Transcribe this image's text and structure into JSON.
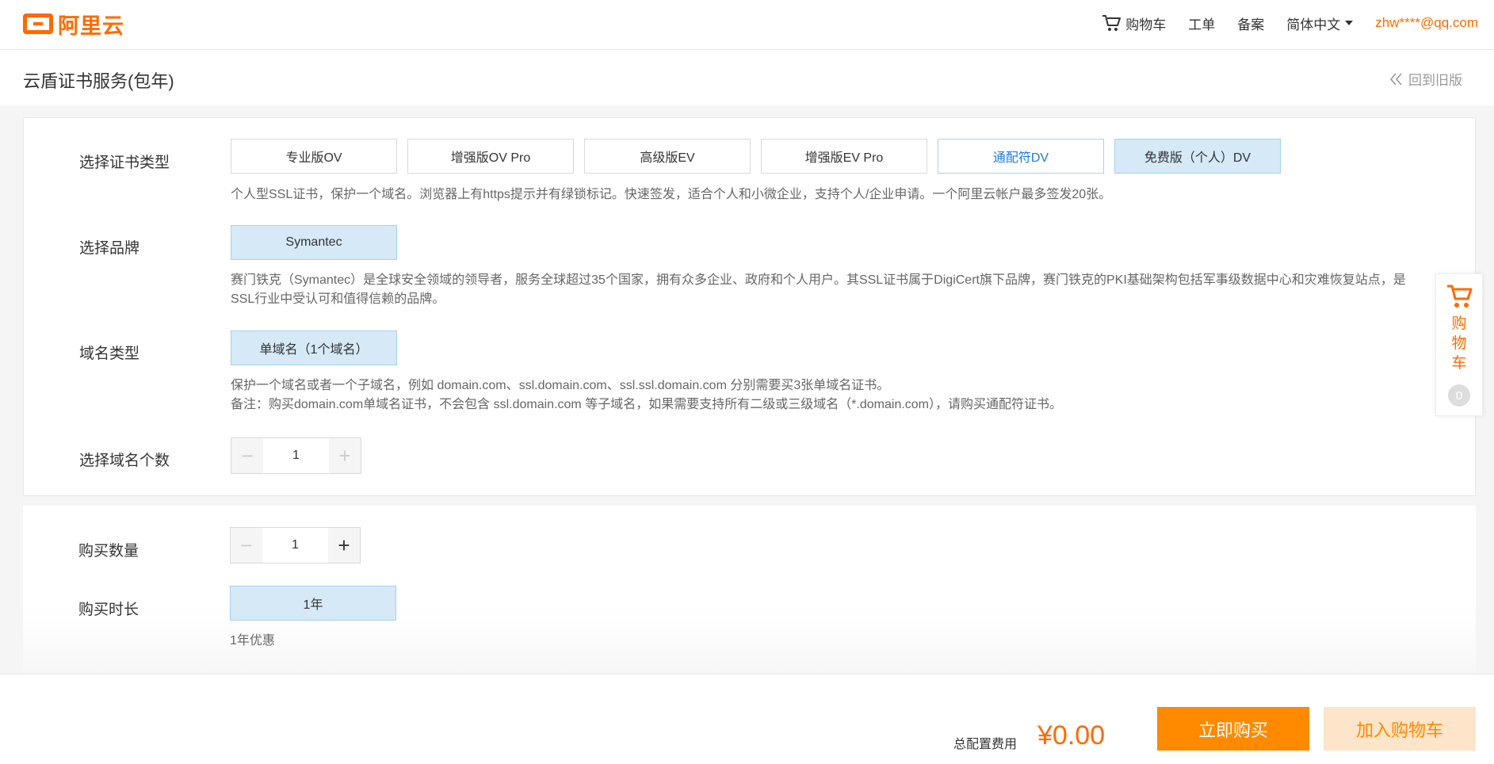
{
  "header": {
    "logo_text": "阿里云",
    "cart_label": "购物车",
    "ticket_label": "工单",
    "filing_label": "备案",
    "language_label": "简体中文",
    "user_label": "zhw****@qq.com"
  },
  "title": {
    "page_title": "云盾证书服务(包年)",
    "back_old_label": "回到旧版"
  },
  "cert_type": {
    "label": "选择证书类型",
    "options": [
      "专业版OV",
      "增强版OV Pro",
      "高级版EV",
      "增强版EV Pro",
      "通配符DV",
      "免费版（个人）DV"
    ],
    "selected": "免费版（个人）DV",
    "desc": "个人型SSL证书，保护一个域名。浏览器上有https提示并有绿锁标记。快速签发，适合个人和小微企业，支持个人/企业申请。一个阿里云帐户最多签发20张。"
  },
  "brand": {
    "label": "选择品牌",
    "option": "Symantec",
    "desc_line1": "赛门铁克（Symantec）是全球安全领域的领导者，服务全球超过35个国家，拥有众多企业、政府和个人用户。其SSL证书属于DigiCert旗下品牌，赛门铁克的PKI基础架构包括军事级数据中心和灾难恢复站点，是",
    "desc_line2": "SSL行业中受认可和值得信赖的品牌。"
  },
  "domain_type": {
    "label": "域名类型",
    "option": "单域名（1个域名）",
    "desc_line1": "保护一个域名或者一个子域名，例如 domain.com、ssl.domain.com、ssl.ssl.domain.com 分别需要买3张单域名证书。",
    "desc_line2": "备注：购买domain.com单域名证书，不会包含 ssl.domain.com 等子域名，如果需要支持所有二级或三级域名（*.domain.com），请购买通配符证书。"
  },
  "domain_count": {
    "label": "选择域名个数",
    "value": "1",
    "minus": "−",
    "plus": "+"
  },
  "quantity": {
    "label": "购买数量",
    "value": "1",
    "minus": "−",
    "plus": "+"
  },
  "duration": {
    "label": "购买时长",
    "option": "1年",
    "note": "1年优惠"
  },
  "float_cart": {
    "label": "购物车",
    "count": "0"
  },
  "footer": {
    "total_label": "总配置费用",
    "total_price": "¥0.00",
    "buy_label": "立即购买",
    "add_cart_label": "加入购物车"
  },
  "colors": {
    "brand_orange": "#ff6a00",
    "selected_bg": "#d5e9f7",
    "link_blue": "#1e7bd8"
  }
}
